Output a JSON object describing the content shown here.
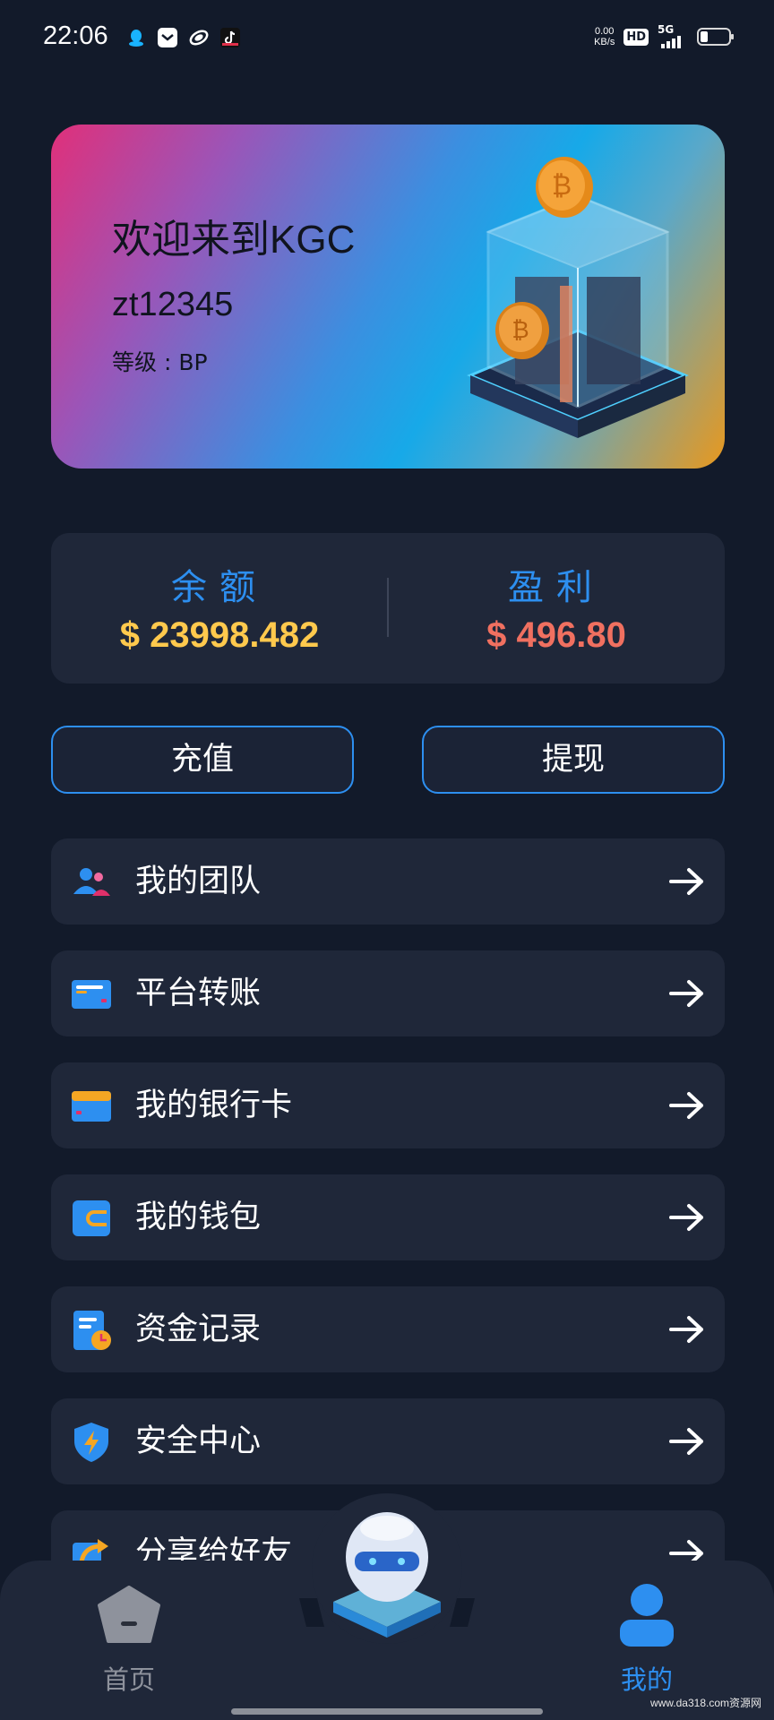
{
  "status_bar": {
    "time": "22:06",
    "notification_icons": [
      "qq-icon",
      "mail-icon",
      "browser-icon",
      "tiktok-icon"
    ],
    "net_speed_value": "0.00",
    "net_speed_unit": "KB/s",
    "hd_badge": "HD",
    "network": "5G"
  },
  "welcome": {
    "title": "欢迎来到KGC",
    "username": "zt12345",
    "level": "等级 : BP"
  },
  "balance": {
    "balance_label": "余额",
    "balance_value": "$ 23998.482",
    "profit_label": "盈利",
    "profit_value": "$ 496.80"
  },
  "actions": {
    "recharge": "充值",
    "withdraw": "提现"
  },
  "menu": {
    "items": [
      {
        "label": "我的团队",
        "icon": "team-icon"
      },
      {
        "label": "平台转账",
        "icon": "transfer-card-icon"
      },
      {
        "label": "我的银行卡",
        "icon": "bank-card-icon"
      },
      {
        "label": "我的钱包",
        "icon": "wallet-icon"
      },
      {
        "label": "资金记录",
        "icon": "fund-record-icon"
      },
      {
        "label": "安全中心",
        "icon": "security-shield-icon"
      },
      {
        "label": "分享给好友",
        "icon": "share-icon"
      }
    ]
  },
  "nav": {
    "home": "首页",
    "mine": "我的"
  },
  "colors": {
    "background": "#121a2a",
    "card": "#1f2739",
    "accent_blue": "#2d8ff0",
    "balance_yellow": "#ffc94d",
    "profit_red": "#f07060"
  },
  "watermark": "www.da318.com资源网"
}
